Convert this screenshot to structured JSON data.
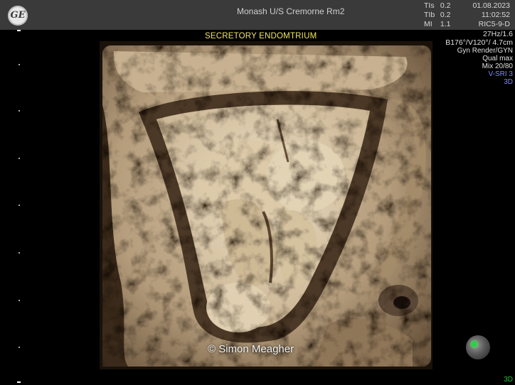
{
  "header": {
    "logo_text": "GE",
    "site": "Monash U/S Cremorne Rm2",
    "readouts": [
      {
        "label": "TIs",
        "value": "0.2"
      },
      {
        "label": "TIb",
        "value": "0.2"
      },
      {
        "label": "MI",
        "value": "1.1"
      }
    ],
    "date": "01.08.2023",
    "time": "11:02:52",
    "probe": "RIC5-9-D"
  },
  "params": {
    "rate": "27Hz/1.6",
    "angles": "B176°/V120°/ 4.7cm",
    "render": "Gyn Render/GYN",
    "quality": "Qual max",
    "mix": "Mix 20/80",
    "vsri": "V-SRI 3",
    "mode": "3D"
  },
  "annotation": "SECRETORY ENDOMTRIUM",
  "copyright": "© Simon Meagher",
  "mode_bottom": "3D",
  "colors": {
    "header_bg": "#3a3a3a",
    "annotation": "#f2e65a",
    "tissue": "#c9b597",
    "cavity": "#e2d2b6",
    "indicator": "#2ed04a"
  },
  "icons": [
    "ge-logo-icon",
    "orientation-orb-icon"
  ]
}
